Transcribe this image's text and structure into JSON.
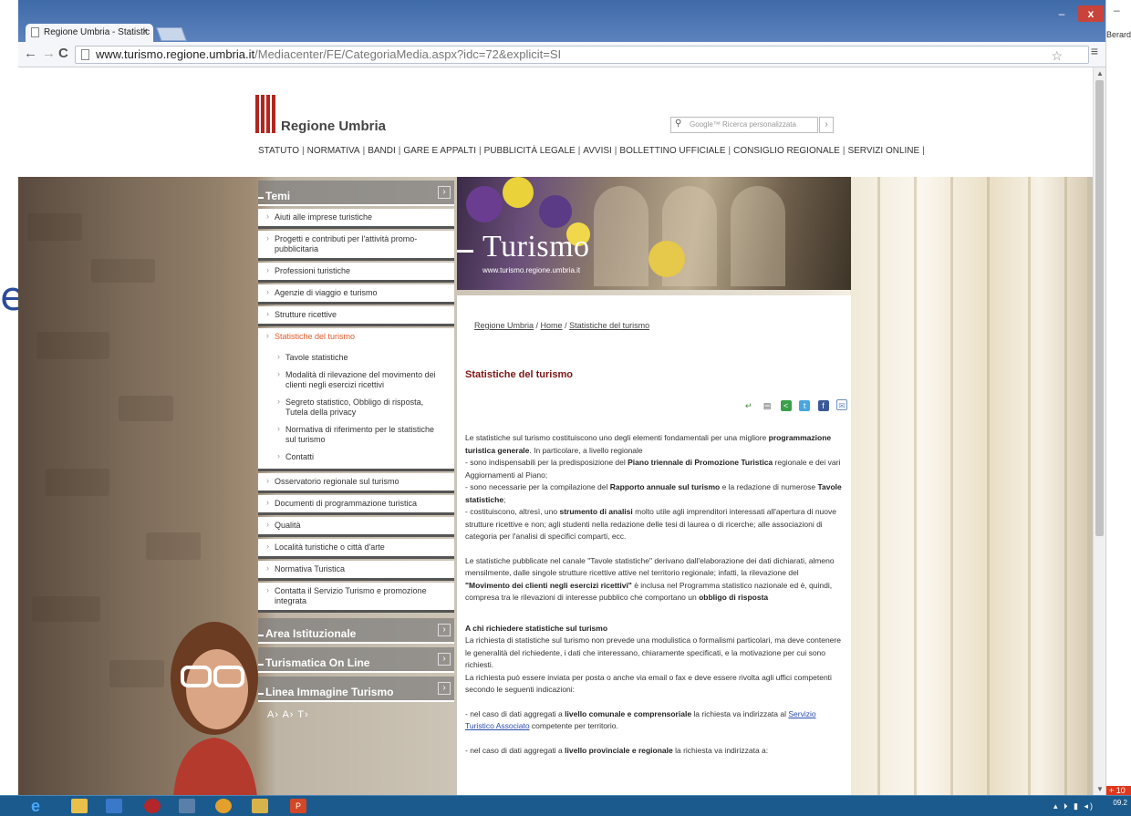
{
  "browser": {
    "tab_title": "Regione Umbria - Statistic",
    "tab_close": "×",
    "url_host": "www.turismo.regione.umbria.it",
    "url_path": "/Mediacenter/FE/CategoriaMedia.aspx?idc=72&explicit=SI",
    "min_label": "–",
    "max_label": "□",
    "close_label": "x",
    "back": "←",
    "forward": "→",
    "reload": "C",
    "star": "☆",
    "menu": "≡"
  },
  "desktop": {
    "right_user": "Berardi",
    "right_dash": "–",
    "left_fragment": "e",
    "notif": "+ 10"
  },
  "header": {
    "site_name": "Regione Umbria",
    "search_placeholder": "Google™ Ricerca personalizzata",
    "search_go": "›",
    "nav": [
      "STATUTO",
      "NORMATIVA",
      "BANDI",
      "GARE E APPALTI",
      "PUBBLICITÀ LEGALE",
      "AVVISI",
      "BOLLETTINO UFFICIALE",
      "CONSIGLIO REGIONALE",
      "SERVIZI ONLINE"
    ],
    "nav_sep": "|"
  },
  "banner": {
    "title": "Turismo",
    "url": "www.turismo.regione.umbria.it"
  },
  "sidebar": {
    "head_temi": "Temi",
    "head_arrow": "›",
    "items": [
      "Aiuti alle imprese turistiche",
      "Progetti e contributi per l'attività promo-pubblicitaria",
      "Professioni turistiche",
      "Agenzie di viaggio e turismo",
      "Strutture ricettive",
      "Statistiche del turismo"
    ],
    "sub_items": [
      "Tavole statistiche",
      "Modalità di rilevazione del movimento dei clienti negli esercizi ricettivi",
      "Segreto statistico, Obbligo di risposta, Tutela della privacy",
      "Normativa di riferimento per le statistiche sul turismo",
      "Contatti"
    ],
    "items_after": [
      "Osservatorio regionale sul turismo",
      "Documenti di programmazione turistica",
      "Qualità",
      "Località turistiche o città d'arte",
      "Normativa Turistica",
      "Contatta il Servizio Turismo e promozione integrata"
    ],
    "head_area": "Area Istituzionale",
    "head_turismatica": "Turismatica On Line",
    "head_linea": "Linea Immagine Turismo",
    "font_controls": "A›  A›  T›"
  },
  "content": {
    "crumb_1": "Regione Umbria",
    "crumb_2": "Home",
    "crumb_3": "Statistiche del turismo",
    "crumb_sep": " / ",
    "title": "Statistiche del turismo",
    "p1_a": "Le statistiche sul turismo costituiscono uno degli elementi fondamentali per una migliore ",
    "p1_b": "programmazione turistica generale",
    "p1_c": ". In particolare, a livello regionale",
    "p1_d": "- sono indispensabili per la predisposizione del ",
    "p1_e": "Piano triennale di Promozione Turistica",
    "p1_f": " regionale e dei vari Aggiornamenti al Piano;",
    "p1_g": "- sono necessarie per la compilazione del ",
    "p1_h": "Rapporto annuale sul turismo",
    "p1_i": " e la redazione di numerose ",
    "p1_j": "Tavole statistiche",
    "p1_k": ";",
    "p1_l": "- costituiscono, altresì, uno ",
    "p1_m": "strumento di analisi",
    "p1_n": " molto utile agli imprenditori interessati all'apertura di nuove strutture ricettive e non; agli studenti nella redazione delle tesi di laurea o di ricerche; alle associazioni di categoria per l'analisi di specifici comparti, ecc.",
    "p2_a": "Le statistiche pubblicate nel canale \"Tavole statistiche\" derivano dall'elaborazione dei dati dichiarati, almeno mensilmente, dalle singole strutture ricettive attive nel territorio regionale; infatti, la rilevazione del ",
    "p2_b": "\"Movimento dei clienti negli esercizi ricettivi\"",
    "p2_c": " è inclusa nel Programma statistico nazionale ed è, quindi, compresa tra le rilevazioni di interesse pubblico che comportano un ",
    "p2_d": "obbligo di risposta",
    "p3_head": "A chi richiedere statistiche sul turismo",
    "p3_a": "La richiesta di statistiche sul turismo non prevede una modulistica o formalismi particolari, ma deve contenere le generalità del richiedente, i dati che interessano, chiaramente specificati, e la motivazione per cui sono richiesti.",
    "p3_b": "La richiesta può essere inviata per posta o anche via email o fax e deve essere rivolta agli uffici competenti secondo le seguenti indicazioni:",
    "p4_a": "- nel caso di dati aggregati a ",
    "p4_b": "livello comunale e comprensoriale",
    "p4_c": " la richiesta va indirizzata al ",
    "p4_link": "Servizio Turistico Associato",
    "p4_d": " competente per territorio.",
    "p5_a": "- nel caso di dati aggregati a ",
    "p5_b": "livello provinciale e regionale",
    "p5_c": " la richiesta va indirizzata a:"
  },
  "taskbar": {
    "clock": "09.2",
    "tray": "▴ ⏵ ▮ ◂)"
  },
  "colors": {
    "title_red": "#7a1515",
    "active_orange": "#e0592a",
    "chrome_blue": "#5b82bd",
    "taskbar": "#1b5a8c"
  }
}
